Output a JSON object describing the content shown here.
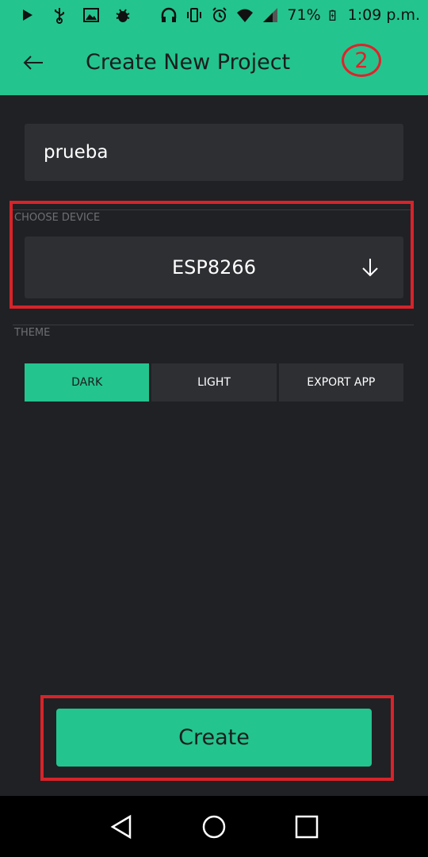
{
  "status_bar": {
    "battery": "71%",
    "time": "1:09 p.m."
  },
  "app_bar": {
    "title": "Create New Project",
    "annotation_number": "2"
  },
  "project": {
    "name_value": "prueba"
  },
  "device": {
    "section_label": "CHOOSE DEVICE",
    "selected": "ESP8266"
  },
  "theme": {
    "section_label": "THEME",
    "options": [
      "DARK",
      "LIGHT",
      "EXPORT APP"
    ],
    "selected": "DARK"
  },
  "actions": {
    "create_label": "Create"
  },
  "colors": {
    "accent": "#24c48e",
    "background": "#202124",
    "field": "#2e2f33",
    "annotation": "#d8232a"
  }
}
